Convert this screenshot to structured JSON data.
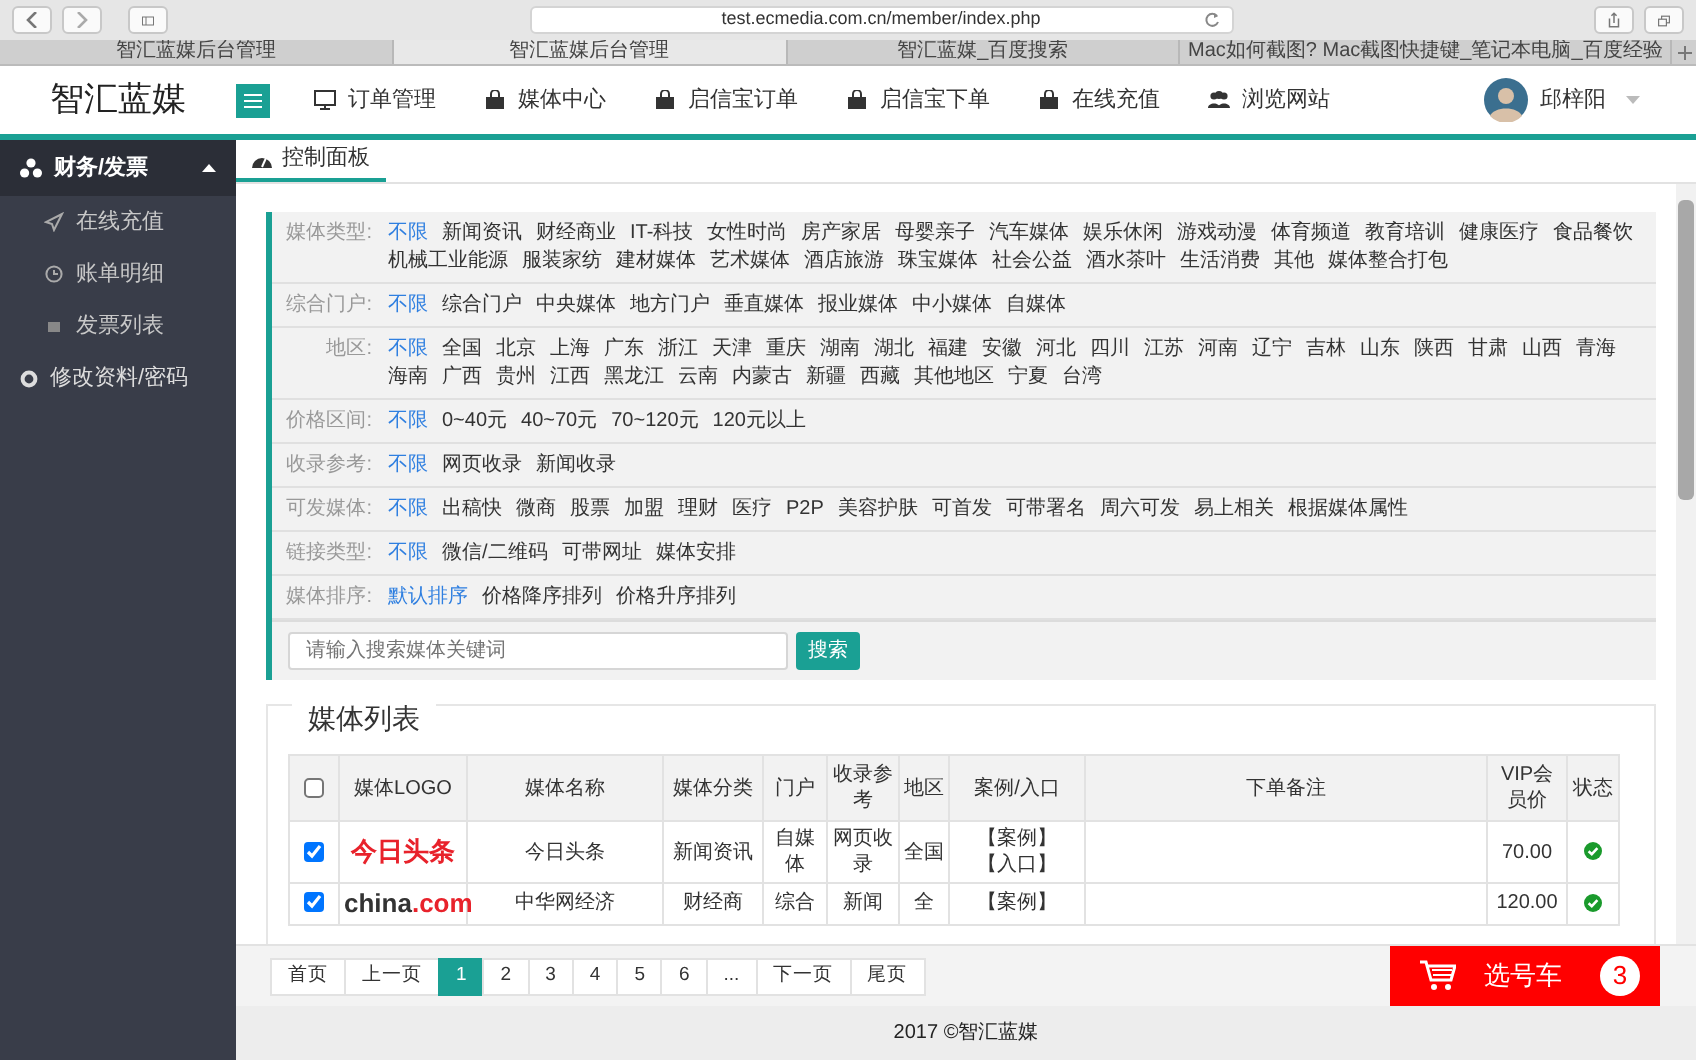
{
  "browser": {
    "url": "test.ecmedia.com.cn/member/index.php",
    "tabs": [
      {
        "title": "智汇蓝媒后台管理",
        "selected": false
      },
      {
        "title": "智汇蓝媒后台管理",
        "selected": true
      },
      {
        "title": "智汇蓝媒_百度搜索",
        "selected": false
      },
      {
        "title": "Mac如何截图? Mac截图快捷键_笔记本电脑_百度经验",
        "selected": false
      }
    ]
  },
  "header": {
    "brand": "智汇蓝媒",
    "nav": [
      {
        "label": "订单管理"
      },
      {
        "label": "媒体中心"
      },
      {
        "label": "启信宝订单"
      },
      {
        "label": "启信宝下单"
      },
      {
        "label": "在线充值"
      },
      {
        "label": "浏览网站"
      }
    ],
    "user": "邱梓阳"
  },
  "sidebar": {
    "items": [
      {
        "label": "财务/发票",
        "expanded": true,
        "children": [
          {
            "label": "在线充值"
          },
          {
            "label": "账单明细"
          },
          {
            "label": "发票列表"
          }
        ]
      },
      {
        "label": "修改资料/密码"
      }
    ]
  },
  "page_tab": "控制面板",
  "filters": [
    {
      "label": "媒体类型:",
      "options": [
        {
          "text": "不限",
          "selected": true
        },
        {
          "text": "新闻资讯",
          "selected": false
        },
        {
          "text": "财经商业",
          "selected": false
        },
        {
          "text": "IT-科技",
          "selected": false
        },
        {
          "text": "女性时尚",
          "selected": false
        },
        {
          "text": "房产家居",
          "selected": false
        },
        {
          "text": "母婴亲子",
          "selected": false
        },
        {
          "text": "汽车媒体",
          "selected": false
        },
        {
          "text": "娱乐休闲",
          "selected": false
        },
        {
          "text": "游戏动漫",
          "selected": false
        },
        {
          "text": "体育频道",
          "selected": false
        },
        {
          "text": "教育培训",
          "selected": false
        },
        {
          "text": "健康医疗",
          "selected": false
        },
        {
          "text": "食品餐饮",
          "selected": false
        },
        {
          "text": "机械工业能源",
          "selected": false
        },
        {
          "text": "服装家纺",
          "selected": false
        },
        {
          "text": "建材媒体",
          "selected": false
        },
        {
          "text": "艺术媒体",
          "selected": false
        },
        {
          "text": "酒店旅游",
          "selected": false
        },
        {
          "text": "珠宝媒体",
          "selected": false
        },
        {
          "text": "社会公益",
          "selected": false
        },
        {
          "text": "酒水茶叶",
          "selected": false
        },
        {
          "text": "生活消费",
          "selected": false
        },
        {
          "text": "其他",
          "selected": false
        },
        {
          "text": "媒体整合打包",
          "selected": false
        }
      ]
    },
    {
      "label": "综合门户:",
      "options": [
        {
          "text": "不限",
          "selected": true
        },
        {
          "text": "综合门户",
          "selected": false
        },
        {
          "text": "中央媒体",
          "selected": false
        },
        {
          "text": "地方门户",
          "selected": false
        },
        {
          "text": "垂直媒体",
          "selected": false
        },
        {
          "text": "报业媒体",
          "selected": false
        },
        {
          "text": "中小媒体",
          "selected": false
        },
        {
          "text": "自媒体",
          "selected": false
        }
      ]
    },
    {
      "label": "地区:",
      "options": [
        {
          "text": "不限",
          "selected": true
        },
        {
          "text": "全国",
          "selected": false
        },
        {
          "text": "北京",
          "selected": false
        },
        {
          "text": "上海",
          "selected": false
        },
        {
          "text": "广东",
          "selected": false
        },
        {
          "text": "浙江",
          "selected": false
        },
        {
          "text": "天津",
          "selected": false
        },
        {
          "text": "重庆",
          "selected": false
        },
        {
          "text": "湖南",
          "selected": false
        },
        {
          "text": "湖北",
          "selected": false
        },
        {
          "text": "福建",
          "selected": false
        },
        {
          "text": "安徽",
          "selected": false
        },
        {
          "text": "河北",
          "selected": false
        },
        {
          "text": "四川",
          "selected": false
        },
        {
          "text": "江苏",
          "selected": false
        },
        {
          "text": "河南",
          "selected": false
        },
        {
          "text": "辽宁",
          "selected": false
        },
        {
          "text": "吉林",
          "selected": false
        },
        {
          "text": "山东",
          "selected": false
        },
        {
          "text": "陕西",
          "selected": false
        },
        {
          "text": "甘肃",
          "selected": false
        },
        {
          "text": "山西",
          "selected": false
        },
        {
          "text": "青海",
          "selected": false
        },
        {
          "text": "海南",
          "selected": false
        },
        {
          "text": "广西",
          "selected": false
        },
        {
          "text": "贵州",
          "selected": false
        },
        {
          "text": "江西",
          "selected": false
        },
        {
          "text": "黑龙江",
          "selected": false
        },
        {
          "text": "云南",
          "selected": false
        },
        {
          "text": "内蒙古",
          "selected": false
        },
        {
          "text": "新疆",
          "selected": false
        },
        {
          "text": "西藏",
          "selected": false
        },
        {
          "text": "其他地区",
          "selected": false
        },
        {
          "text": "宁夏",
          "selected": false
        },
        {
          "text": "台湾",
          "selected": false
        }
      ]
    },
    {
      "label": "价格区间:",
      "options": [
        {
          "text": "不限",
          "selected": true
        },
        {
          "text": "0~40元",
          "selected": false
        },
        {
          "text": "40~70元",
          "selected": false
        },
        {
          "text": "70~120元",
          "selected": false
        },
        {
          "text": "120元以上",
          "selected": false
        }
      ]
    },
    {
      "label": "收录参考:",
      "options": [
        {
          "text": "不限",
          "selected": true
        },
        {
          "text": "网页收录",
          "selected": false
        },
        {
          "text": "新闻收录",
          "selected": false
        }
      ]
    },
    {
      "label": "可发媒体:",
      "options": [
        {
          "text": "不限",
          "selected": true
        },
        {
          "text": "出稿快",
          "selected": false
        },
        {
          "text": "微商",
          "selected": false
        },
        {
          "text": "股票",
          "selected": false
        },
        {
          "text": "加盟",
          "selected": false
        },
        {
          "text": "理财",
          "selected": false
        },
        {
          "text": "医疗",
          "selected": false
        },
        {
          "text": "P2P",
          "selected": false
        },
        {
          "text": "美容护肤",
          "selected": false
        },
        {
          "text": "可首发",
          "selected": false
        },
        {
          "text": "可带署名",
          "selected": false
        },
        {
          "text": "周六可发",
          "selected": false
        },
        {
          "text": "易上相关",
          "selected": false
        },
        {
          "text": "根据媒体属性",
          "selected": false
        }
      ]
    },
    {
      "label": "链接类型:",
      "options": [
        {
          "text": "不限",
          "selected": true
        },
        {
          "text": "微信/二维码",
          "selected": false
        },
        {
          "text": "可带网址",
          "selected": false
        },
        {
          "text": "媒体安排",
          "selected": false
        }
      ]
    },
    {
      "label": "媒体排序:",
      "options": [
        {
          "text": "默认排序",
          "selected": true
        },
        {
          "text": "价格降序排列",
          "selected": false
        },
        {
          "text": "价格升序排列",
          "selected": false
        }
      ]
    }
  ],
  "search": {
    "placeholder": "请输入搜索媒体关键词",
    "button": "搜索"
  },
  "media_list": {
    "title": "媒体列表",
    "columns": [
      "媒体LOGO",
      "媒体名称",
      "媒体分类",
      "门户",
      "收录参考",
      "地区",
      "案例/入口",
      "下单备注",
      "VIP会员价",
      "状态"
    ],
    "header_checked": false,
    "rows": [
      {
        "checked": true,
        "logo": {
          "kind": "toutiao",
          "parts": [
            "今日头条"
          ]
        },
        "name": "今日头条",
        "category": "新闻资讯",
        "portal": "自媒体",
        "index": "网页收录",
        "region": "全国",
        "links": [
          "【案例】",
          "【入口】"
        ],
        "price": "70.00",
        "status": {
          "kind": "check"
        }
      },
      {
        "checked": true,
        "logo": {
          "kind": "china",
          "parts": [
            "china",
            ".com"
          ]
        },
        "name": "中华网经济",
        "category": "财经商",
        "portal": "综合",
        "index": "新闻",
        "region": "全",
        "links": [
          "【案例】"
        ],
        "price": "120.00",
        "status": {
          "kind": "check"
        }
      }
    ]
  },
  "pagination": [
    {
      "text": "首页",
      "selected": false
    },
    {
      "text": "上一页",
      "selected": false
    },
    {
      "text": "1",
      "selected": true
    },
    {
      "text": "2",
      "selected": false
    },
    {
      "text": "3",
      "selected": false
    },
    {
      "text": "4",
      "selected": false
    },
    {
      "text": "5",
      "selected": false
    },
    {
      "text": "6",
      "selected": false
    },
    {
      "text": "...",
      "selected": false
    },
    {
      "text": "下一页",
      "selected": false
    },
    {
      "text": "尾页",
      "selected": false
    }
  ],
  "cart": {
    "label": "选号车",
    "count": "3"
  },
  "footer": "2017 ©智汇蓝媒"
}
